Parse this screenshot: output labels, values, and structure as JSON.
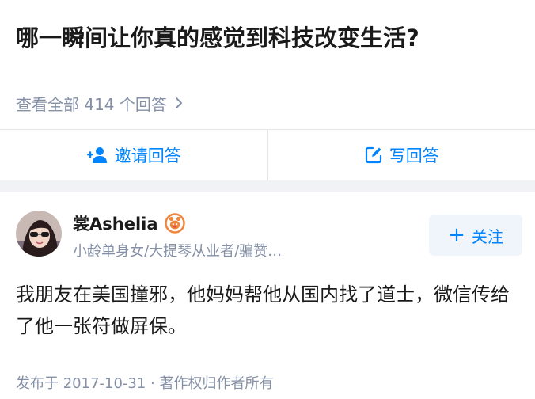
{
  "question": {
    "title": "哪一瞬间让你真的感觉到科技改变生活?",
    "view_all_label": "查看全部 414 个回答"
  },
  "actions": {
    "invite_label": "邀请回答",
    "write_label": "写回答"
  },
  "answer": {
    "author_name": "裳Ashelia",
    "author_bio": "小龄单身女/大提琴从业者/骗赞…",
    "follow_label": "关注",
    "content": "我朋友在美国撞邪，他妈妈帮他从国内找了道士，微信传给了他一张符做屏保。",
    "meta": "发布于 2017-10-31 · 著作权归作者所有"
  },
  "icons": {
    "invite": "add-user-icon",
    "write": "edit-icon",
    "chevron": "chevron-right-icon",
    "badge": "member-badge-icon",
    "follow_plus": "plus-icon"
  },
  "colors": {
    "accent": "#0084ff",
    "secondary_text": "#8590a6",
    "primary_text": "#1a1a1a",
    "divider": "#e6e6e6",
    "follow_bg": "#f0f5fc",
    "badge": "#f1853b"
  }
}
